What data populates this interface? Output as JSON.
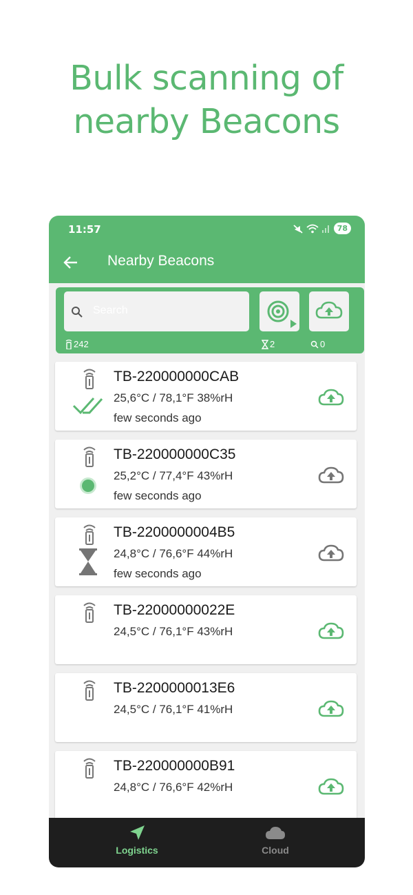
{
  "headline": {
    "line1": "Bulk scanning of",
    "line2": "nearby Beacons"
  },
  "status_bar": {
    "time": "11:57",
    "battery": "78"
  },
  "app_bar": {
    "title": "Nearby Beacons"
  },
  "toolbar": {
    "search_placeholder": "Search",
    "beacon_count": "242",
    "pending_count": "2",
    "search_count": "0"
  },
  "beacons": [
    {
      "name": "TB-220000000CAB",
      "reading": "25,6°C / 78,1°F  38%rH",
      "time": "few seconds ago",
      "status": "uploaded"
    },
    {
      "name": "TB-220000000C35",
      "reading": "25,2°C / 77,4°F  43%rH",
      "time": "few seconds ago",
      "status": "active"
    },
    {
      "name": "TB-2200000004B5",
      "reading": "24,8°C / 76,6°F  44%rH",
      "time": "few seconds ago",
      "status": "pending"
    },
    {
      "name": "TB-22000000022E",
      "reading": "24,5°C / 76,1°F  43%rH",
      "time": "",
      "status": "none"
    },
    {
      "name": "TB-2200000013E6",
      "reading": "24,5°C / 76,1°F  41%rH",
      "time": "",
      "status": "none"
    },
    {
      "name": "TB-220000000B91",
      "reading": "24,8°C / 76,6°F  42%rH",
      "time": "",
      "status": "none"
    }
  ],
  "bottom_nav": {
    "logistics": "Logistics",
    "cloud": "Cloud"
  },
  "colors": {
    "accent": "#5bb872",
    "nav_bg": "#1e1e1e",
    "nav_active": "#7fd48f",
    "nav_inactive": "#8a8a8a",
    "pending_gray": "#757575"
  }
}
